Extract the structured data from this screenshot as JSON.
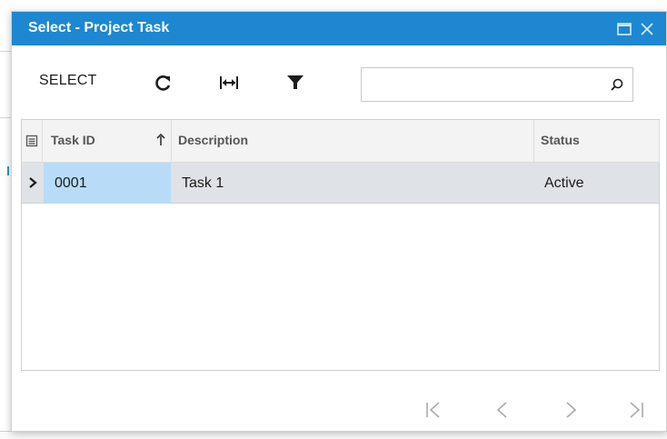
{
  "dialog": {
    "title": "Select - Project Task",
    "maximize_icon": "maximize-icon",
    "close_icon": "close-icon"
  },
  "toolbar": {
    "select_label": "SELECT",
    "refresh_icon": "refresh-icon",
    "fit_columns_icon": "fit-columns-icon",
    "filter_icon": "filter-icon",
    "search": {
      "value": "",
      "placeholder": ""
    },
    "search_icon": "search-icon"
  },
  "grid": {
    "columns": [
      {
        "label": "Task ID",
        "sort": "ascending"
      },
      {
        "label": "Description"
      },
      {
        "label": "Status"
      }
    ],
    "rows": [
      {
        "task_id": "0001",
        "description": "Task 1",
        "status": "Active",
        "selected": true
      }
    ]
  },
  "pager": [
    "first-page-icon",
    "previous-page-icon",
    "next-page-icon",
    "last-page-icon"
  ],
  "colors": {
    "titlebar": "#1d87d1",
    "selected_cell": "#b8dcf7",
    "selected_row": "#dfe2e7"
  }
}
